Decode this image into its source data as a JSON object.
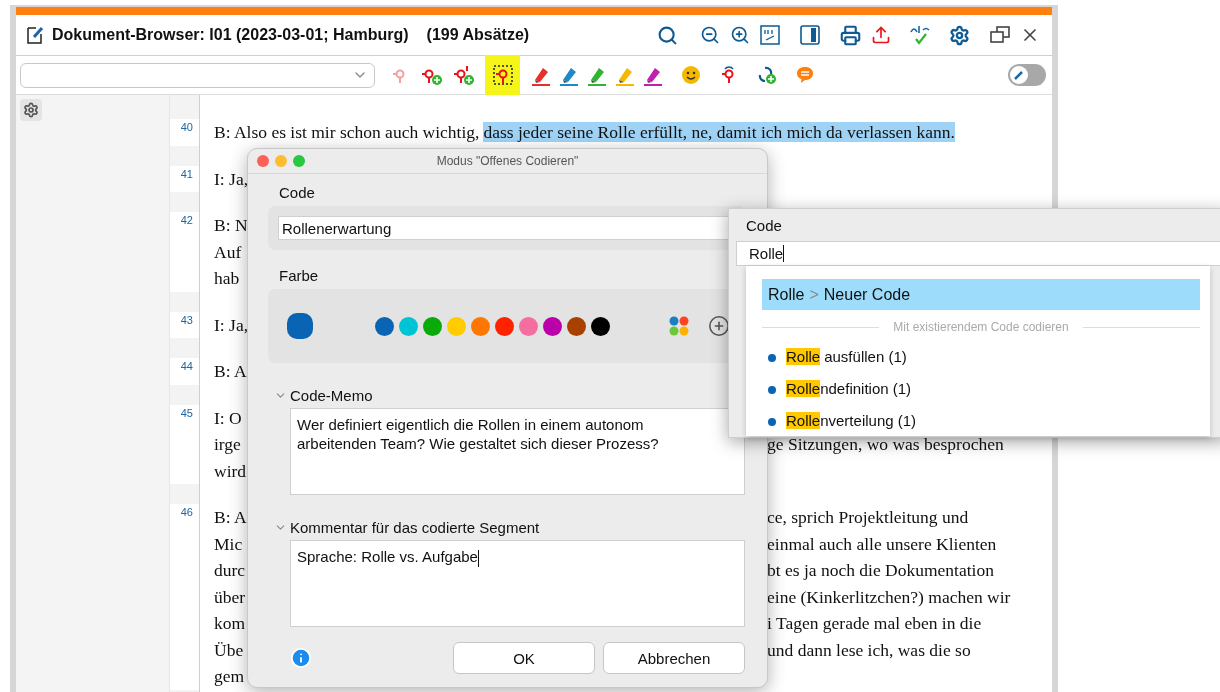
{
  "window": {
    "title": "Dokument-Browser: I01 (2023-03-01; Hamburg)",
    "count": "(199 Absätze)"
  },
  "toolbar": {
    "tools": [
      {
        "kind": "pin",
        "selected": false
      },
      {
        "kind": "pin-plus",
        "selected": false
      },
      {
        "kind": "pin-info-plus",
        "selected": false
      },
      {
        "kind": "pin-frame",
        "selected": true
      },
      {
        "kind": "marker",
        "color": "#e8302a",
        "selected": false
      },
      {
        "kind": "marker",
        "color": "#1e88c8",
        "selected": false
      },
      {
        "kind": "marker",
        "color": "#2fb52f",
        "selected": false
      },
      {
        "kind": "marker",
        "color": "#f5b800",
        "selected": false
      },
      {
        "kind": "marker",
        "color": "#c21fb0",
        "selected": false
      },
      {
        "kind": "smiley",
        "selected": false
      },
      {
        "kind": "pin-refresh",
        "selected": false
      },
      {
        "kind": "link-plus",
        "selected": false
      },
      {
        "kind": "comment",
        "selected": false
      }
    ],
    "edit_mode": {
      "on": false
    }
  },
  "paragraphs": [
    {
      "number": "40",
      "lines": [
        {
          "left": "B: Also es ist mir schon auch wichtig,",
          "highlighted": "dass jeder seine Rolle erfüllt, ne, damit ich mich da verlassen kann."
        }
      ]
    },
    {
      "number": "41",
      "lines": [
        {
          "left": "I: Ja,"
        }
      ]
    },
    {
      "number": "42",
      "lines": [
        {
          "left": "B: N"
        },
        {
          "left": "Auf"
        },
        {
          "left": "hab"
        }
      ]
    },
    {
      "number": "43",
      "lines": [
        {
          "left": "I: Ja,"
        }
      ]
    },
    {
      "number": "44",
      "lines": [
        {
          "left": "B: A"
        }
      ]
    },
    {
      "number": "45",
      "lines": [
        {
          "left": "I: O"
        },
        {
          "left": "irge",
          "right": "ge Sitzungen, wo was besprochen"
        },
        {
          "left": "wird"
        }
      ]
    },
    {
      "number": "46",
      "lines": [
        {
          "left": "B: A",
          "right": "ce, sprich Projektleitung und"
        },
        {
          "left": "Mic",
          "right": "einmal auch alle unsere Klienten"
        },
        {
          "left": "durc",
          "right": "bt es ja noch die Dokumentation"
        },
        {
          "left": "über",
          "right": "eine (Kinkerlitzchen?) machen wir"
        },
        {
          "left": "kom",
          "right": "i Tagen gerade mal eben in die"
        },
        {
          "left": "Übe",
          "right": "und dann lese ich, was die so"
        },
        {
          "left": "gem"
        }
      ]
    }
  ],
  "dialog": {
    "title": "Modus \"Offenes Codieren\"",
    "code": {
      "label": "Code",
      "value": "Rollenerwartung"
    },
    "color": {
      "label": "Farbe",
      "current": {
        "color": "#0a64b4"
      },
      "palette": [
        {
          "color": "#0a64b4"
        },
        {
          "color": "#00c4d4"
        },
        {
          "color": "#0aaa0a"
        },
        {
          "color": "#ffcc00"
        },
        {
          "color": "#ff7700"
        },
        {
          "color": "#ff2200"
        },
        {
          "color": "#f46fa0"
        },
        {
          "color": "#bb00aa"
        },
        {
          "color": "#a84000"
        },
        {
          "color": "#000000"
        }
      ]
    },
    "memo": {
      "label": "Code-Memo",
      "expanded": true,
      "value": "Wer definiert eigentlich die Rollen in einem autonom arbeitenden Team? Wie gestaltet sich dieser Prozess?"
    },
    "comment": {
      "label": "Kommentar für das codierte Segment",
      "expanded": true,
      "value": "Sprache: Rolle vs. Aufgabe"
    },
    "buttons": [
      "OK",
      "Abbrechen"
    ]
  },
  "popup": {
    "label": "Code",
    "value": "Rolle",
    "new_code": {
      "parent": "Rolle",
      "separator": ">",
      "name": "Neuer Code",
      "selected": true
    },
    "section": "Mit existierendem Code codieren",
    "matches": [
      {
        "match": "Rolle",
        "rest": "ausfüllen (1)",
        "joined": false,
        "color": "#0a64b4"
      },
      {
        "match": "Rolle",
        "rest": "ndefinition (1)",
        "joined": true,
        "color": "#0a64b4"
      },
      {
        "match": "Rolle",
        "rest": "nverteilung (1)",
        "joined": true,
        "color": "#0a64b4"
      }
    ]
  }
}
